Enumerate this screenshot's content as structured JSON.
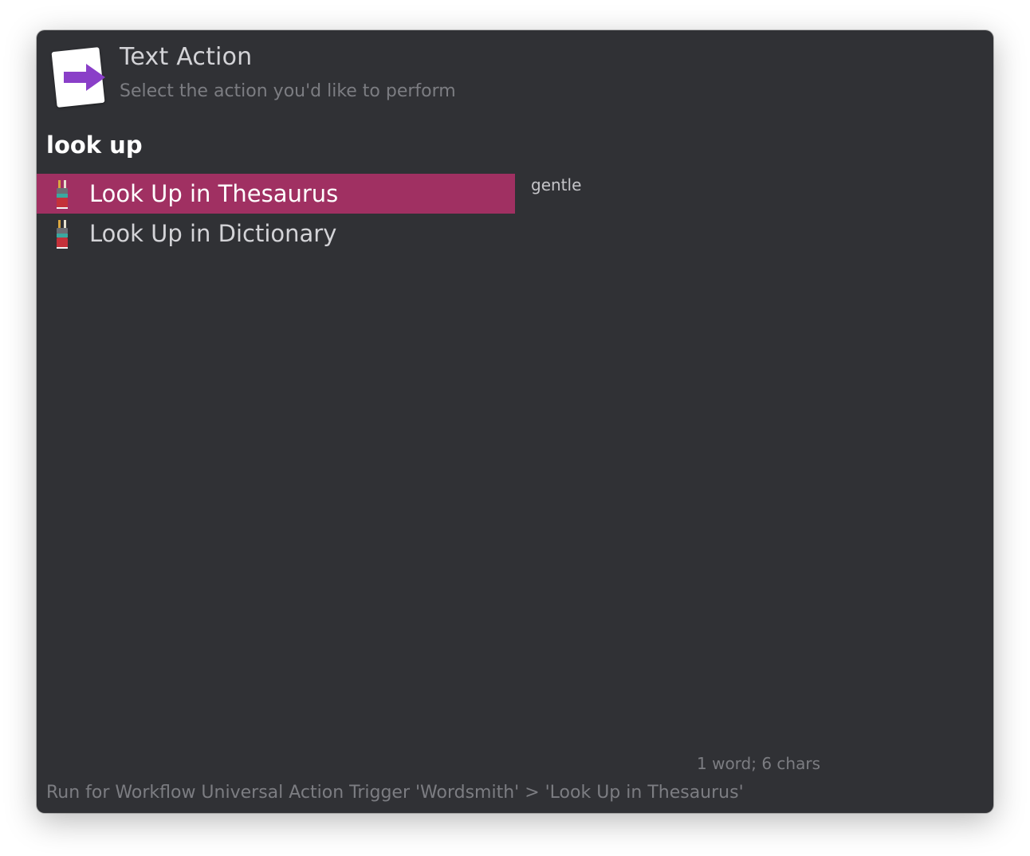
{
  "header": {
    "title": "Text Action",
    "subtitle": "Select the action you'd like to perform",
    "icon": "right-arrow-document-icon"
  },
  "search": {
    "value": "look up"
  },
  "results": [
    {
      "label": "Look Up in Thesaurus",
      "icon": "wordsmith-pen-icon",
      "selected": true
    },
    {
      "label": "Look Up in Dictionary",
      "icon": "wordsmith-pen-icon",
      "selected": false
    }
  ],
  "preview": {
    "text": "gentle",
    "stats": "1 word; 6 chars"
  },
  "status": {
    "text": "Run for Workflow Universal Action Trigger 'Wordsmith' > 'Look Up in Thesaurus'"
  },
  "colors": {
    "window_bg": "#303135",
    "selection": "#a03062",
    "arrow": "#8a3fc8",
    "primary_text": "#d3d3d7",
    "secondary_text": "#7c7d82"
  }
}
